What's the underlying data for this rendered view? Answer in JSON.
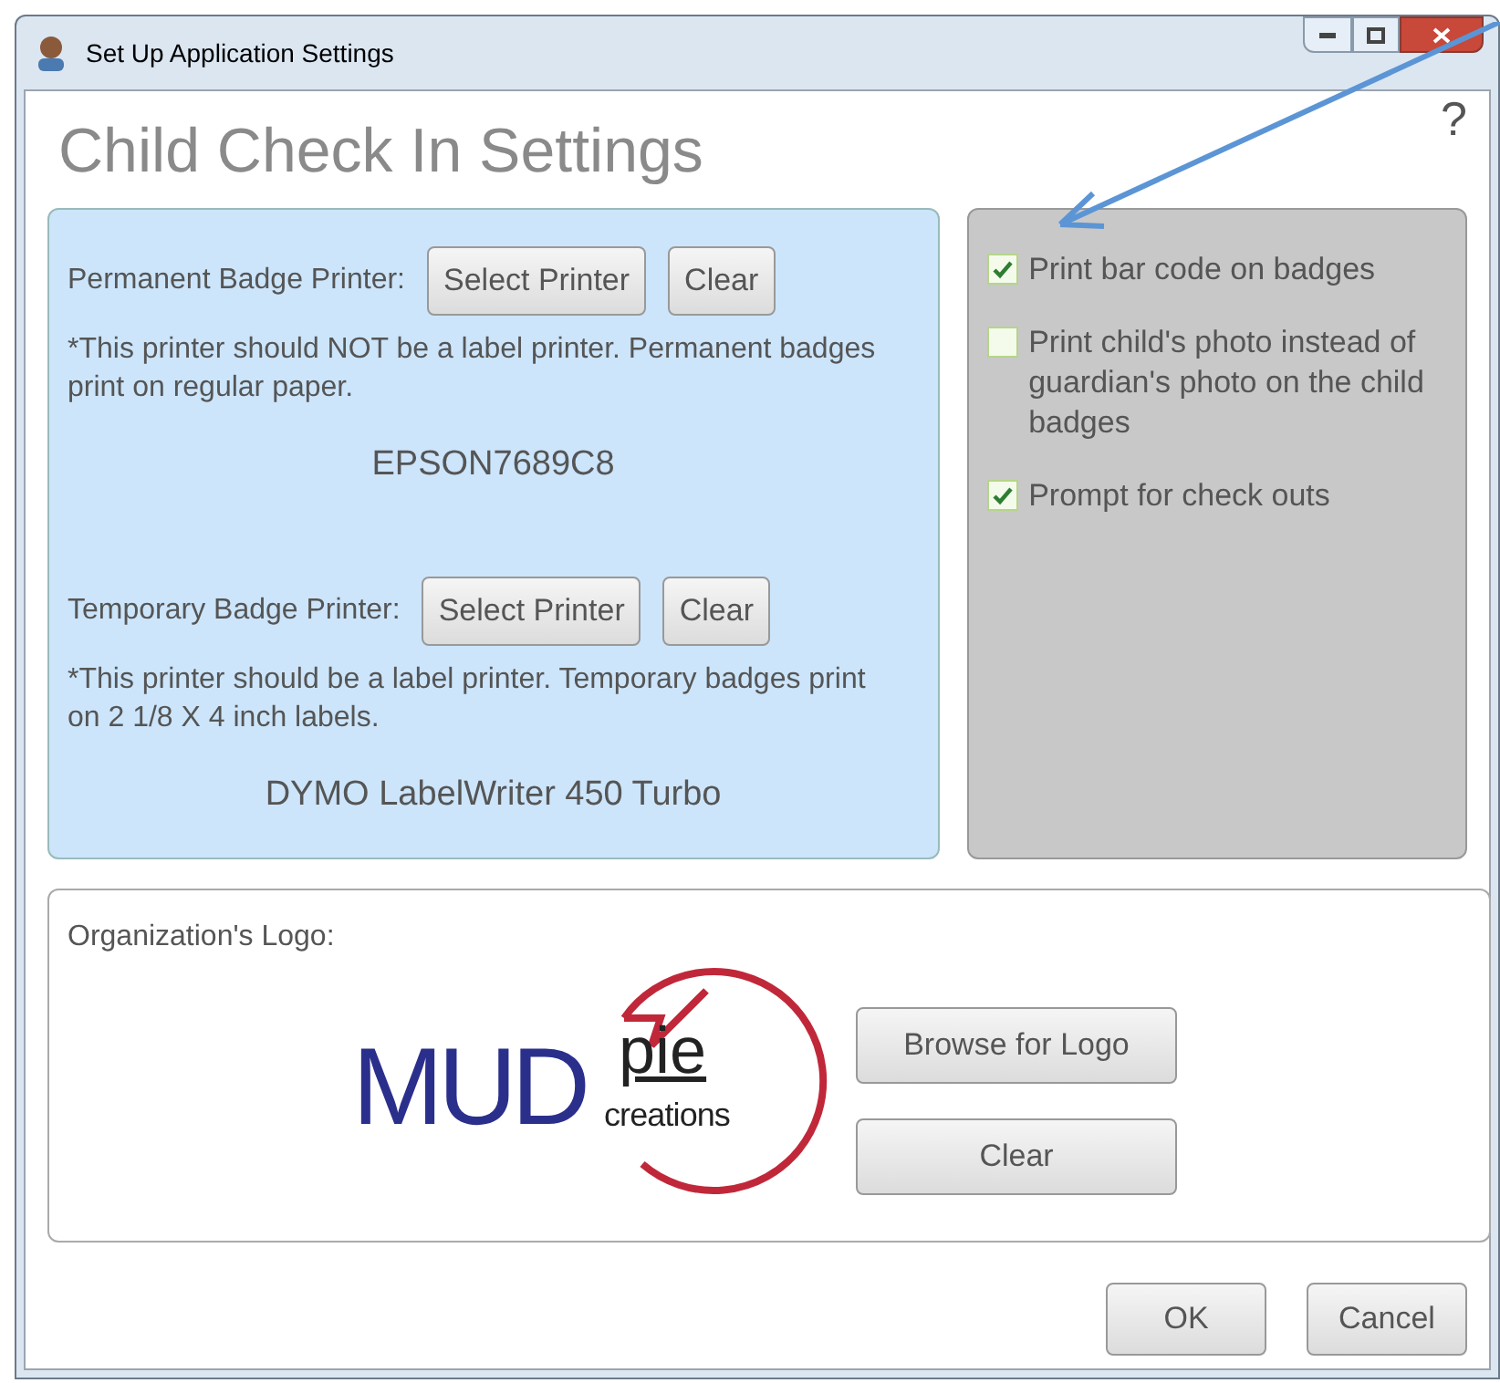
{
  "window": {
    "title": "Set Up Application Settings"
  },
  "heading": "Child Check In Settings",
  "help": "?",
  "printers": [
    {
      "label": "Permanent Badge Printer:",
      "select_button": "Select Printer",
      "clear_button": "Clear",
      "note": "*This printer should NOT be a label printer.  Permanent badges print on regular paper.",
      "printer_name": "EPSON7689C8"
    },
    {
      "label": "Temporary Badge Printer:",
      "select_button": "Select Printer",
      "clear_button": "Clear",
      "note": "*This printer should be a label printer.  Temporary badges print on 2 1/8 X 4 inch labels.",
      "printer_name": "DYMO LabelWriter 450 Turbo"
    }
  ],
  "options": [
    {
      "label": "Print bar code on badges",
      "checked": true
    },
    {
      "label": "Print child's photo instead of guardian's photo on the child badges",
      "checked": false
    },
    {
      "label": "Prompt for check outs",
      "checked": true
    }
  ],
  "logo_section": {
    "label": "Organization's Logo:",
    "logo": {
      "main": "MUD",
      "sub": "pie",
      "tagline": "creations"
    },
    "browse_button": "Browse for Logo",
    "clear_button": "Clear"
  },
  "buttons": [
    "OK",
    "Cancel"
  ]
}
